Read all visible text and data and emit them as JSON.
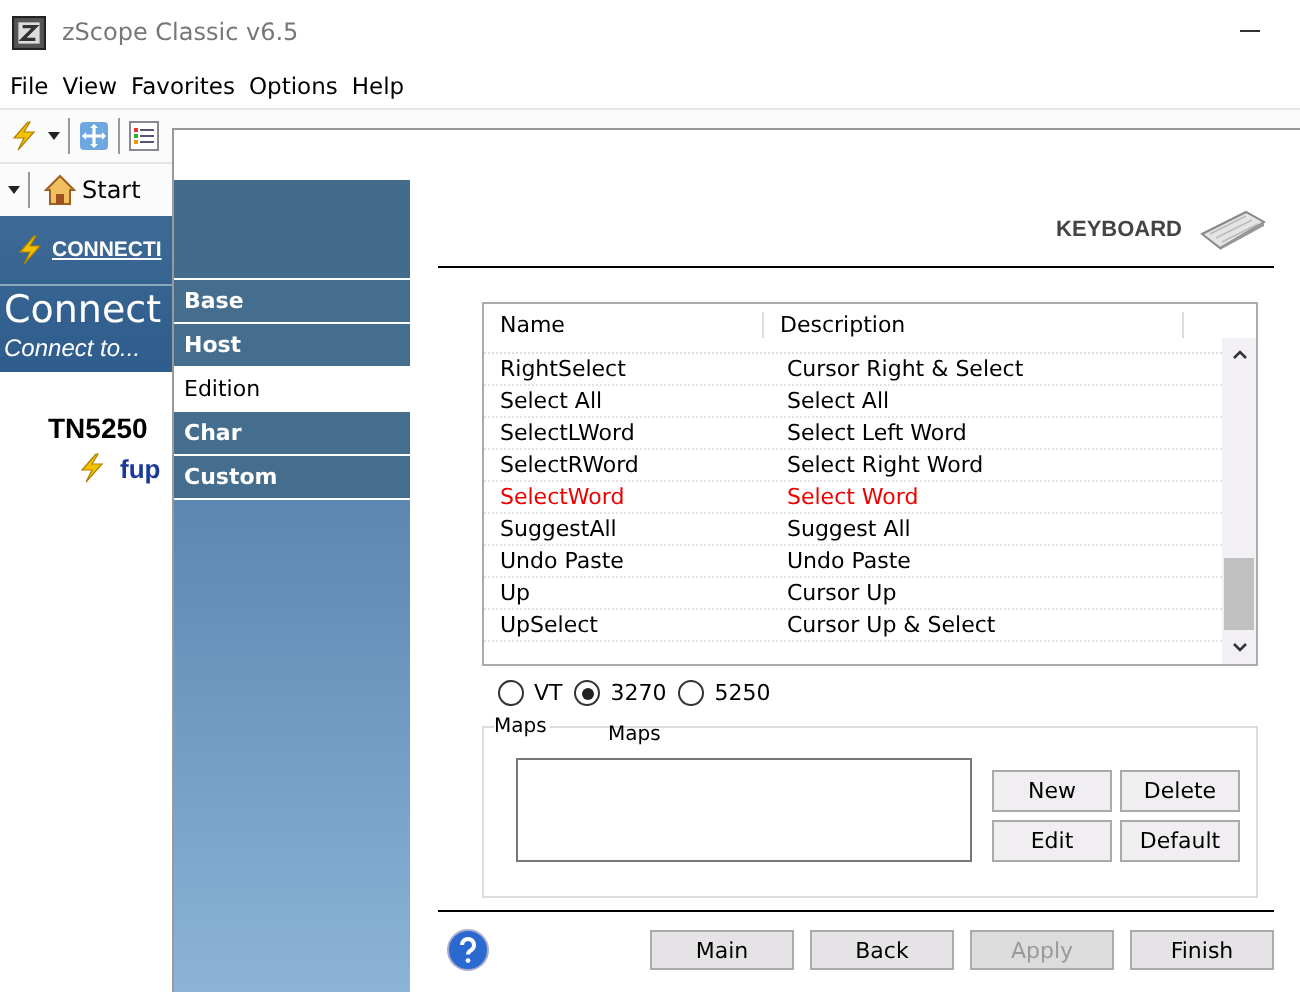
{
  "window": {
    "title": "zScope Classic v6.5"
  },
  "menu": [
    "File",
    "View",
    "Favorites",
    "Options",
    "Help"
  ],
  "start_button": "Start",
  "banner": {
    "link": "CONNECTI",
    "heading": "Connect",
    "subheading": "Connect to..."
  },
  "tree": {
    "group": "TN5250",
    "item": "fup"
  },
  "dialog": {
    "nav": [
      {
        "label": "Base",
        "selected": false
      },
      {
        "label": "Host",
        "selected": false
      },
      {
        "label": "Edition",
        "selected": true
      },
      {
        "label": "Char",
        "selected": false
      },
      {
        "label": "Custom",
        "selected": false
      }
    ],
    "header": "KEYBOARD",
    "table": {
      "columns": [
        "Name",
        "Description"
      ],
      "rows": [
        {
          "name": "RightSelect",
          "description": "Cursor Right & Select",
          "highlighted": false
        },
        {
          "name": "Select All",
          "description": "Select All",
          "highlighted": false
        },
        {
          "name": "SelectLWord",
          "description": "Select Left Word",
          "highlighted": false
        },
        {
          "name": "SelectRWord",
          "description": "Select Right Word",
          "highlighted": false
        },
        {
          "name": "SelectWord",
          "description": "Select Word",
          "highlighted": true
        },
        {
          "name": "SuggestAll",
          "description": "Suggest All",
          "highlighted": false
        },
        {
          "name": "Undo Paste",
          "description": "Undo Paste",
          "highlighted": false
        },
        {
          "name": "Up",
          "description": "Cursor Up",
          "highlighted": false
        },
        {
          "name": "UpSelect",
          "description": "Cursor Up & Select",
          "highlighted": false
        }
      ]
    },
    "radios": [
      {
        "label": "VT",
        "selected": false
      },
      {
        "label": "3270",
        "selected": true
      },
      {
        "label": "5250",
        "selected": false
      }
    ],
    "maps": {
      "legend": "Maps",
      "label": "Maps",
      "buttons": [
        "New",
        "Delete",
        "Edit",
        "Default"
      ]
    },
    "footer_buttons": [
      {
        "label": "Main",
        "disabled": false
      },
      {
        "label": "Back",
        "disabled": false
      },
      {
        "label": "Apply",
        "disabled": true
      },
      {
        "label": "Finish",
        "disabled": false
      }
    ]
  }
}
